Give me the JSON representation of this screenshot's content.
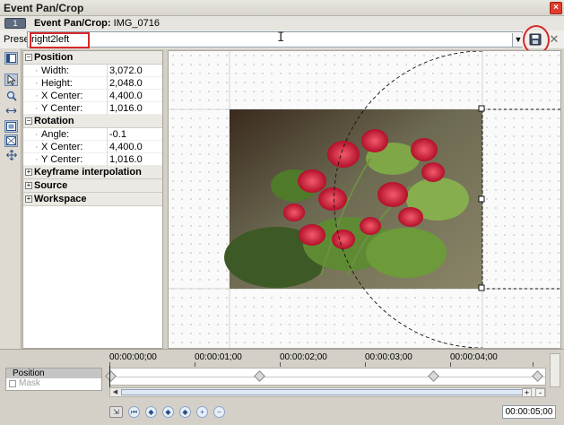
{
  "window": {
    "title": "Event Pan/Crop"
  },
  "header": {
    "icon_text": "1",
    "title_prefix": "Event Pan/Crop:",
    "clip_name": "IMG_0716"
  },
  "preset": {
    "label": "Preset:",
    "value": "right2left"
  },
  "properties": {
    "groups": [
      {
        "name": "Position",
        "expanded": true,
        "items": [
          {
            "name": "Width:",
            "value": "3,072.0"
          },
          {
            "name": "Height:",
            "value": "2,048.0"
          },
          {
            "name": "X Center:",
            "value": "4,400.0"
          },
          {
            "name": "Y Center:",
            "value": "1,016.0"
          }
        ]
      },
      {
        "name": "Rotation",
        "expanded": true,
        "items": [
          {
            "name": "Angle:",
            "value": "-0.1"
          },
          {
            "name": "X Center:",
            "value": "4,400.0"
          },
          {
            "name": "Y Center:",
            "value": "1,016.0"
          }
        ]
      },
      {
        "name": "Keyframe interpolation",
        "expanded": false,
        "items": []
      },
      {
        "name": "Source",
        "expanded": false,
        "items": []
      },
      {
        "name": "Workspace",
        "expanded": false,
        "items": []
      }
    ]
  },
  "timeline": {
    "tracks": [
      {
        "name": "Position"
      },
      {
        "name": "Mask"
      }
    ],
    "ruler": [
      "00:00:00;00",
      "00:00:01;00",
      "00:00:02;00",
      "00:00:03;00",
      "00:00:04;00"
    ],
    "timecode": "00:00:05;00",
    "zoom_in": "+",
    "zoom_out": "-"
  },
  "icons": {
    "save": "save-disk-icon",
    "delete": "close-x-icon",
    "dropdown": "chevron-down-icon"
  },
  "colors": {
    "callout": "#d6292a",
    "selection": "#bcc9db"
  }
}
